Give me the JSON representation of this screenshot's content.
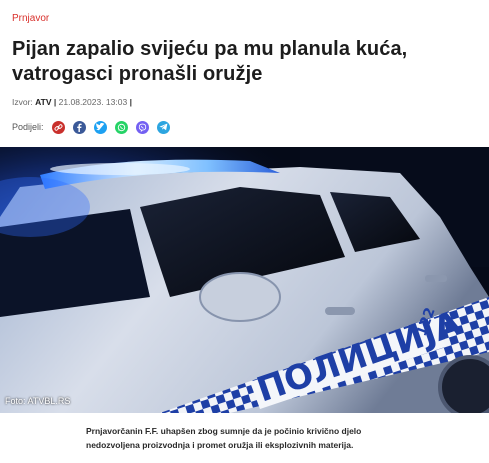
{
  "article": {
    "category": "Prnjavor",
    "title": "Pijan zapalio svijeću pa mu planula kuća, vatrogasci pronašli oružje",
    "source_label": "Izvor:",
    "source": "ATV",
    "date": "21.08.2023. 13:03",
    "share_label": "Podijeli:",
    "photo_credit": "Foto: ATVBL.RS",
    "car_text": "ПОЛИЦИЈА",
    "car_number": "122",
    "lead": "Prnjavorčanin F.F. uhapšen zbog sumnje da je počinio krivično djelo nedozvoljena proizvodnja i promet oružja ili eksplozivnih materija."
  },
  "share_buttons": [
    {
      "icon": "link-icon",
      "color": "#c9302c"
    },
    {
      "icon": "facebook-icon",
      "color": "#3b5998"
    },
    {
      "icon": "twitter-icon",
      "color": "#1da1f2"
    },
    {
      "icon": "whatsapp-icon",
      "color": "#25d366"
    },
    {
      "icon": "viber-icon",
      "color": "#7360f2"
    },
    {
      "icon": "telegram-icon",
      "color": "#2ca5e0"
    }
  ],
  "colors": {
    "accent": "#d9302b",
    "siren": "#4aa6ff"
  }
}
